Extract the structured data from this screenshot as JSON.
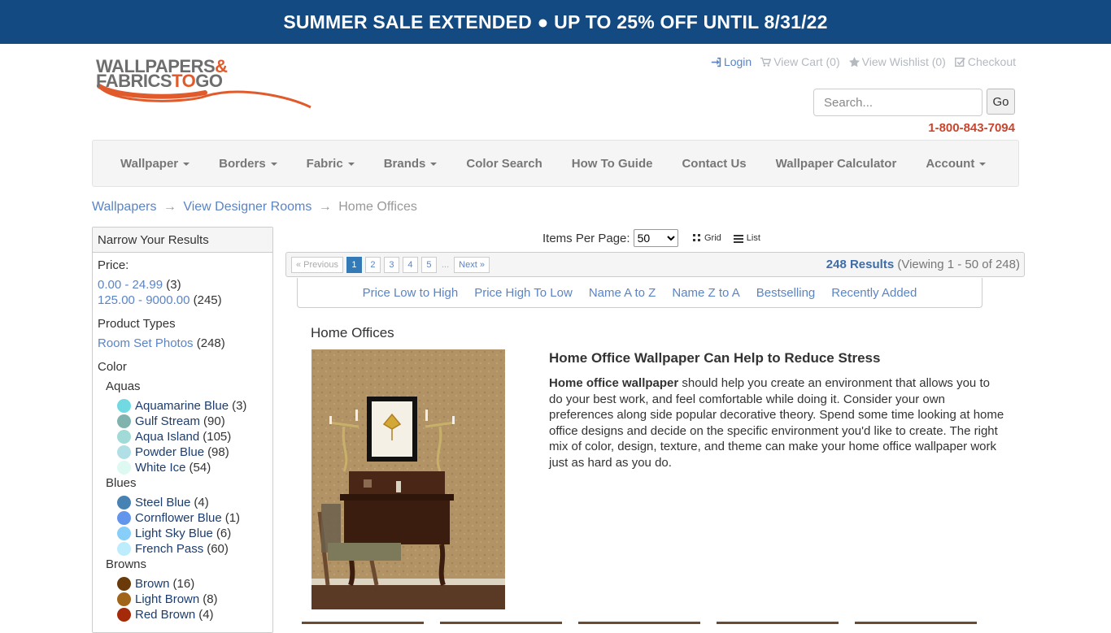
{
  "banner": {
    "text": "SUMMER SALE EXTENDED ● UP TO 25% OFF UNTIL 8/31/22"
  },
  "logo": {
    "line1": "WALLPAPERS",
    "amp": "&",
    "line2a": "FABRICS",
    "line2b": "TO",
    "line2c": "GO"
  },
  "toplinks": {
    "login": "Login",
    "cart": "View Cart (0)",
    "wishlist": "View Wishlist (0)",
    "checkout": "Checkout"
  },
  "search": {
    "placeholder": "Search...",
    "button": "Go"
  },
  "phone": "1-800-843-7094",
  "nav": [
    {
      "label": "Wallpaper",
      "dropdown": true
    },
    {
      "label": "Borders",
      "dropdown": true
    },
    {
      "label": "Fabric",
      "dropdown": true
    },
    {
      "label": "Brands",
      "dropdown": true
    },
    {
      "label": "Color Search",
      "dropdown": false
    },
    {
      "label": "How To Guide",
      "dropdown": false
    },
    {
      "label": "Contact Us",
      "dropdown": false
    },
    {
      "label": "Wallpaper Calculator",
      "dropdown": false
    },
    {
      "label": "Account",
      "dropdown": true
    }
  ],
  "breadcrumb": {
    "items": [
      "Wallpapers",
      "View Designer Rooms"
    ],
    "current": "Home Offices",
    "separator": "→"
  },
  "sidebar": {
    "title": "Narrow Your Results",
    "price_label": "Price:",
    "prices": [
      {
        "label": "0.00 - 24.99",
        "count": "(3)"
      },
      {
        "label": "125.00 - 9000.00",
        "count": "(245)"
      }
    ],
    "product_types_label": "Product Types",
    "product_types": [
      {
        "label": "Room Set Photos",
        "count": "(248)"
      }
    ],
    "color_label": "Color",
    "color_groups": [
      {
        "name": "Aquas",
        "colors": [
          {
            "label": "Aquamarine Blue",
            "count": "(3)",
            "hex": "#71d9e2"
          },
          {
            "label": "Gulf Stream",
            "count": "(90)",
            "hex": "#80b3ae"
          },
          {
            "label": "Aqua Island",
            "count": "(105)",
            "hex": "#a1dad7"
          },
          {
            "label": "Powder Blue",
            "count": "(98)",
            "hex": "#b0e0e6"
          },
          {
            "label": "White Ice",
            "count": "(54)",
            "hex": "#ddf9f1"
          }
        ]
      },
      {
        "name": "Blues",
        "colors": [
          {
            "label": "Steel Blue",
            "count": "(4)",
            "hex": "#4682b4"
          },
          {
            "label": "Cornflower Blue",
            "count": "(1)",
            "hex": "#6495ed"
          },
          {
            "label": "Light Sky Blue",
            "count": "(6)",
            "hex": "#87cefa"
          },
          {
            "label": "French Pass",
            "count": "(60)",
            "hex": "#bdedfd"
          }
        ]
      },
      {
        "name": "Browns",
        "colors": [
          {
            "label": "Brown",
            "count": "(16)",
            "hex": "#6b3a0b"
          },
          {
            "label": "Light Brown",
            "count": "(8)",
            "hex": "#a0651a"
          },
          {
            "label": "Red Brown",
            "count": "(4)",
            "hex": "#a52a0a"
          }
        ]
      }
    ]
  },
  "listing": {
    "items_per_page_label": "Items Per Page:",
    "items_per_page": "50",
    "grid_label": "Grid",
    "list_label": "List",
    "pager": {
      "prev": "« Previous",
      "pages": [
        "1",
        "2",
        "3",
        "4",
        "5"
      ],
      "ellipsis": "...",
      "next": "Next »"
    },
    "results_count": "248 Results",
    "results_viewing": "(Viewing 1 - 50 of 248)",
    "sort_options": [
      "Price Low to High",
      "Price High To Low",
      "Name A to Z",
      "Name Z to A",
      "Bestselling",
      "Recently Added"
    ]
  },
  "content": {
    "title": "Home Offices",
    "article_heading": "Home Office Wallpaper Can Help to Reduce Stress",
    "article_bold": "Home office wallpaper",
    "article_text": " should help you create an environment that allows you to do your best work, and feel comfortable while doing it. Consider your own preferences along side popular decorative theory. Spend some time looking at home office designs and decide on the specific environment you'd like to create. The right mix of color, design, texture, and theme can make your home office wallpaper work just as hard as you do."
  },
  "colors": {
    "banner": "#134a82",
    "link": "#5b84c5",
    "phone": "#c9452e",
    "accent_orange": "#e05a2b"
  }
}
